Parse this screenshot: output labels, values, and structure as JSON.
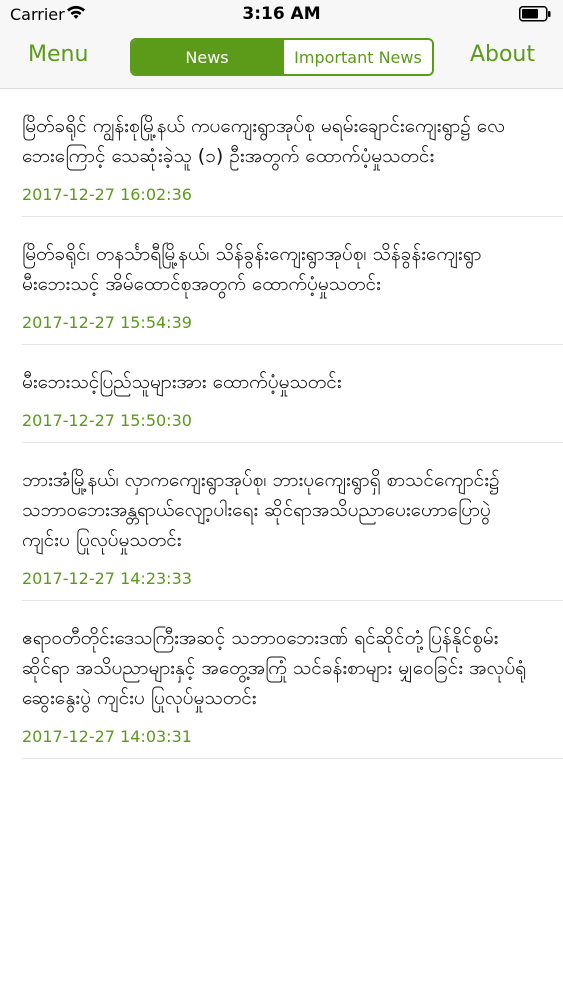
{
  "status_bar": {
    "carrier": "Carrier",
    "time": "3:16 AM",
    "wifi_icon": "wifi-icon",
    "battery_icon": "battery-icon"
  },
  "nav": {
    "menu_label": "Menu",
    "about_label": "About",
    "tabs": [
      {
        "label": "News",
        "active": true
      },
      {
        "label": "Important News",
        "active": false
      }
    ]
  },
  "colors": {
    "accent": "#5c9a1a",
    "background": "#ffffff",
    "bar": "#f7f7f7"
  },
  "news": [
    {
      "title": "မြိတ်ခရိုင် ကျွန်းစုမြို့နယ် ကပကျေးရွာအုပ်စု မရမ်းချောင်းကျေးရွာ၌ လေဘေးကြောင့် သေဆုံးခဲ့သူ (၁) ဦးအတွက် ထောက်ပံ့မှုသတင်း",
      "date": "2017-12-27 16:02:36"
    },
    {
      "title": "မြိတ်ခရိုင်၊ တနင်္သာရီမြို့နယ်၊ သိန်ခွန်းကျေးရွာအုပ်စု၊ သိန်ခွန်းကျေးရွာ မီးဘေးသင့် အိမ်ထောင်စုအတွက် ထောက်ပံ့မှုသတင်း",
      "date": "2017-12-27 15:54:39"
    },
    {
      "title": "မီးဘေးသင့်ပြည်သူများအား ထောက်ပံ့မှုသတင်း",
      "date": "2017-12-27 15:50:30"
    },
    {
      "title": "ဘားအံမြို့နယ်၊ လှာကကျေးရွာအုပ်စု၊ ဘားပုကျေးရွာရှိ စာသင်ကျောင်း၌ သဘာဝဘေးအန္တရာယ်လျော့ပါးရေး ဆိုင်ရာအသိပညာပေးဟောပြောပွဲ ကျင်းပ ပြုလုပ်မှုသတင်း",
      "date": "2017-12-27 14:23:33"
    },
    {
      "title": "ဧရာဝတီတိုင်းဒေသကြီးအဆင့် သဘာဝဘေးဒဏ် ရင်ဆိုင်တုံ့ပြန်နိုင်စွမ်းဆိုင်ရာ အသိပညာများနှင့် အတွေ့အကြုံ သင်ခန်းစာများ မျှဝေခြင်း အလုပ်ရုံဆွေးနွေးပွဲ ကျင်းပ ပြုလုပ်မှုသတင်း",
      "date": "2017-12-27 14:03:31"
    }
  ]
}
